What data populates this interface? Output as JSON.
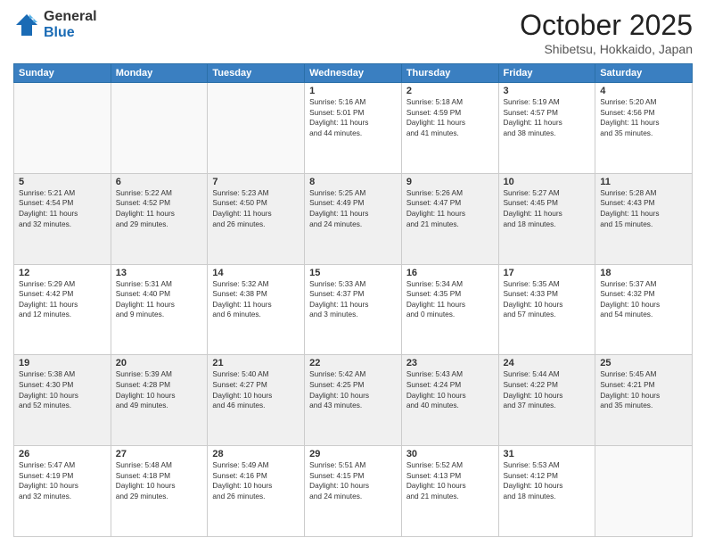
{
  "logo": {
    "general": "General",
    "blue": "Blue"
  },
  "header": {
    "month": "October 2025",
    "location": "Shibetsu, Hokkaido, Japan"
  },
  "weekdays": [
    "Sunday",
    "Monday",
    "Tuesday",
    "Wednesday",
    "Thursday",
    "Friday",
    "Saturday"
  ],
  "weeks": [
    [
      {
        "day": "",
        "info": ""
      },
      {
        "day": "",
        "info": ""
      },
      {
        "day": "",
        "info": ""
      },
      {
        "day": "1",
        "info": "Sunrise: 5:16 AM\nSunset: 5:01 PM\nDaylight: 11 hours\nand 44 minutes."
      },
      {
        "day": "2",
        "info": "Sunrise: 5:18 AM\nSunset: 4:59 PM\nDaylight: 11 hours\nand 41 minutes."
      },
      {
        "day": "3",
        "info": "Sunrise: 5:19 AM\nSunset: 4:57 PM\nDaylight: 11 hours\nand 38 minutes."
      },
      {
        "day": "4",
        "info": "Sunrise: 5:20 AM\nSunset: 4:56 PM\nDaylight: 11 hours\nand 35 minutes."
      }
    ],
    [
      {
        "day": "5",
        "info": "Sunrise: 5:21 AM\nSunset: 4:54 PM\nDaylight: 11 hours\nand 32 minutes."
      },
      {
        "day": "6",
        "info": "Sunrise: 5:22 AM\nSunset: 4:52 PM\nDaylight: 11 hours\nand 29 minutes."
      },
      {
        "day": "7",
        "info": "Sunrise: 5:23 AM\nSunset: 4:50 PM\nDaylight: 11 hours\nand 26 minutes."
      },
      {
        "day": "8",
        "info": "Sunrise: 5:25 AM\nSunset: 4:49 PM\nDaylight: 11 hours\nand 24 minutes."
      },
      {
        "day": "9",
        "info": "Sunrise: 5:26 AM\nSunset: 4:47 PM\nDaylight: 11 hours\nand 21 minutes."
      },
      {
        "day": "10",
        "info": "Sunrise: 5:27 AM\nSunset: 4:45 PM\nDaylight: 11 hours\nand 18 minutes."
      },
      {
        "day": "11",
        "info": "Sunrise: 5:28 AM\nSunset: 4:43 PM\nDaylight: 11 hours\nand 15 minutes."
      }
    ],
    [
      {
        "day": "12",
        "info": "Sunrise: 5:29 AM\nSunset: 4:42 PM\nDaylight: 11 hours\nand 12 minutes."
      },
      {
        "day": "13",
        "info": "Sunrise: 5:31 AM\nSunset: 4:40 PM\nDaylight: 11 hours\nand 9 minutes."
      },
      {
        "day": "14",
        "info": "Sunrise: 5:32 AM\nSunset: 4:38 PM\nDaylight: 11 hours\nand 6 minutes."
      },
      {
        "day": "15",
        "info": "Sunrise: 5:33 AM\nSunset: 4:37 PM\nDaylight: 11 hours\nand 3 minutes."
      },
      {
        "day": "16",
        "info": "Sunrise: 5:34 AM\nSunset: 4:35 PM\nDaylight: 11 hours\nand 0 minutes."
      },
      {
        "day": "17",
        "info": "Sunrise: 5:35 AM\nSunset: 4:33 PM\nDaylight: 10 hours\nand 57 minutes."
      },
      {
        "day": "18",
        "info": "Sunrise: 5:37 AM\nSunset: 4:32 PM\nDaylight: 10 hours\nand 54 minutes."
      }
    ],
    [
      {
        "day": "19",
        "info": "Sunrise: 5:38 AM\nSunset: 4:30 PM\nDaylight: 10 hours\nand 52 minutes."
      },
      {
        "day": "20",
        "info": "Sunrise: 5:39 AM\nSunset: 4:28 PM\nDaylight: 10 hours\nand 49 minutes."
      },
      {
        "day": "21",
        "info": "Sunrise: 5:40 AM\nSunset: 4:27 PM\nDaylight: 10 hours\nand 46 minutes."
      },
      {
        "day": "22",
        "info": "Sunrise: 5:42 AM\nSunset: 4:25 PM\nDaylight: 10 hours\nand 43 minutes."
      },
      {
        "day": "23",
        "info": "Sunrise: 5:43 AM\nSunset: 4:24 PM\nDaylight: 10 hours\nand 40 minutes."
      },
      {
        "day": "24",
        "info": "Sunrise: 5:44 AM\nSunset: 4:22 PM\nDaylight: 10 hours\nand 37 minutes."
      },
      {
        "day": "25",
        "info": "Sunrise: 5:45 AM\nSunset: 4:21 PM\nDaylight: 10 hours\nand 35 minutes."
      }
    ],
    [
      {
        "day": "26",
        "info": "Sunrise: 5:47 AM\nSunset: 4:19 PM\nDaylight: 10 hours\nand 32 minutes."
      },
      {
        "day": "27",
        "info": "Sunrise: 5:48 AM\nSunset: 4:18 PM\nDaylight: 10 hours\nand 29 minutes."
      },
      {
        "day": "28",
        "info": "Sunrise: 5:49 AM\nSunset: 4:16 PM\nDaylight: 10 hours\nand 26 minutes."
      },
      {
        "day": "29",
        "info": "Sunrise: 5:51 AM\nSunset: 4:15 PM\nDaylight: 10 hours\nand 24 minutes."
      },
      {
        "day": "30",
        "info": "Sunrise: 5:52 AM\nSunset: 4:13 PM\nDaylight: 10 hours\nand 21 minutes."
      },
      {
        "day": "31",
        "info": "Sunrise: 5:53 AM\nSunset: 4:12 PM\nDaylight: 10 hours\nand 18 minutes."
      },
      {
        "day": "",
        "info": ""
      }
    ]
  ]
}
